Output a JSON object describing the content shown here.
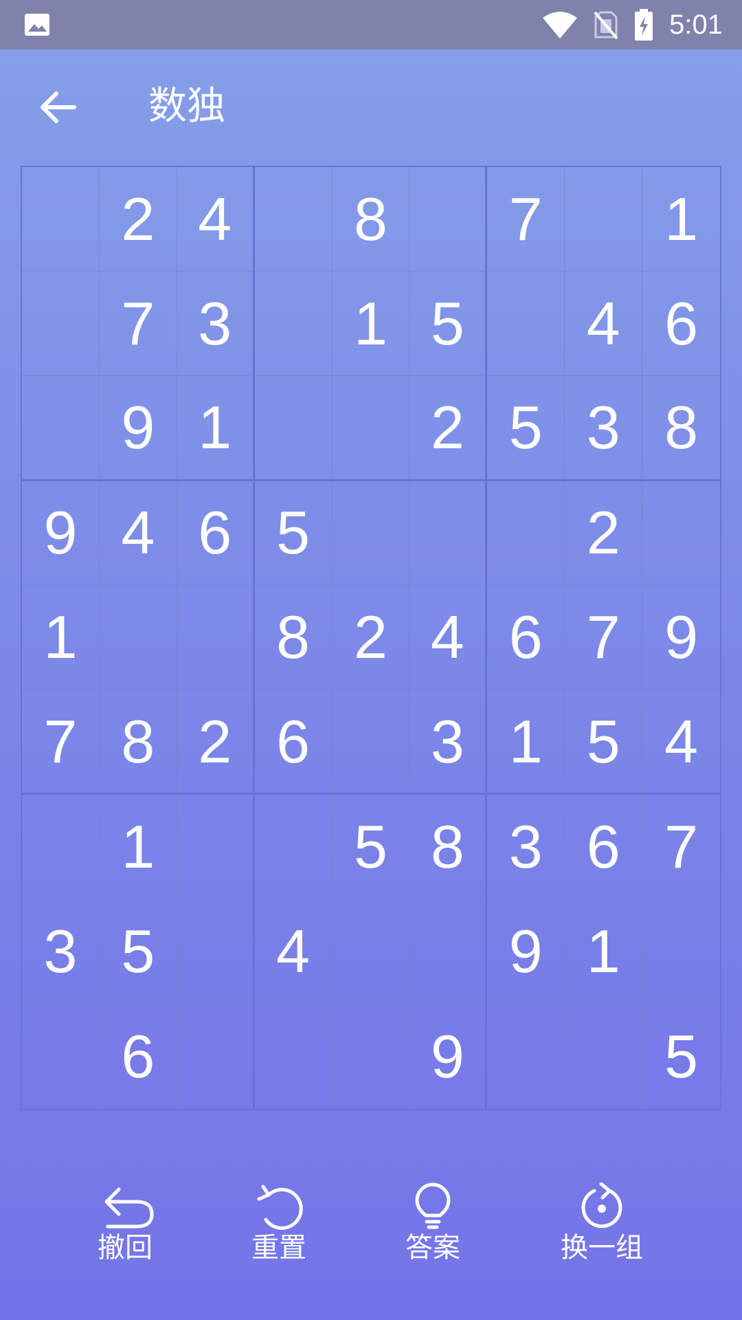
{
  "status_bar": {
    "time": "5:01",
    "icons": [
      "image-icon",
      "wifi-icon",
      "no-sim-icon",
      "battery-charging-icon"
    ]
  },
  "header": {
    "title": "数独",
    "back_icon": "arrow-left-icon"
  },
  "board": {
    "rows": [
      [
        "",
        "2",
        "4",
        "",
        "8",
        "",
        "7",
        "",
        "1"
      ],
      [
        "",
        "7",
        "3",
        "",
        "1",
        "5",
        "",
        "4",
        "6"
      ],
      [
        "",
        "9",
        "1",
        "",
        "",
        "2",
        "5",
        "3",
        "8"
      ],
      [
        "9",
        "4",
        "6",
        "5",
        "",
        "",
        "",
        "2",
        ""
      ],
      [
        "1",
        "",
        "",
        "8",
        "2",
        "4",
        "6",
        "7",
        "9"
      ],
      [
        "7",
        "8",
        "2",
        "6",
        "",
        "3",
        "1",
        "5",
        "4"
      ],
      [
        "",
        "1",
        "",
        "",
        "5",
        "8",
        "3",
        "6",
        "7"
      ],
      [
        "3",
        "5",
        "",
        "4",
        "",
        "",
        "9",
        "1",
        ""
      ],
      [
        "",
        "6",
        "",
        "",
        "",
        "9",
        "",
        "",
        "5"
      ]
    ]
  },
  "toolbar": {
    "undo_label": "撤回",
    "reset_label": "重置",
    "answer_label": "答案",
    "new_set_label": "换一组"
  }
}
